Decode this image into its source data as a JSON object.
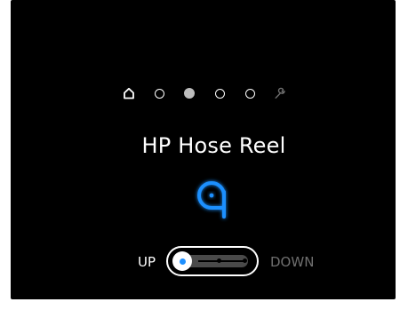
{
  "title": "HP Hose Reel",
  "page_indicator": {
    "items": [
      {
        "type": "home-icon",
        "active": false
      },
      {
        "type": "dot",
        "active": false
      },
      {
        "type": "dot",
        "active": true
      },
      {
        "type": "dot",
        "active": false
      },
      {
        "type": "dot",
        "active": false
      },
      {
        "type": "wrench-icon",
        "active": false
      }
    ]
  },
  "device_icon": "hose-reel-icon",
  "direction_toggle": {
    "left_label": "UP",
    "right_label": "DOWN",
    "selected": "UP"
  },
  "colors": {
    "background": "#000000",
    "accent": "#1e90ff",
    "active_dot": "#bdbdbd",
    "inactive_label": "#6f6f6f"
  }
}
